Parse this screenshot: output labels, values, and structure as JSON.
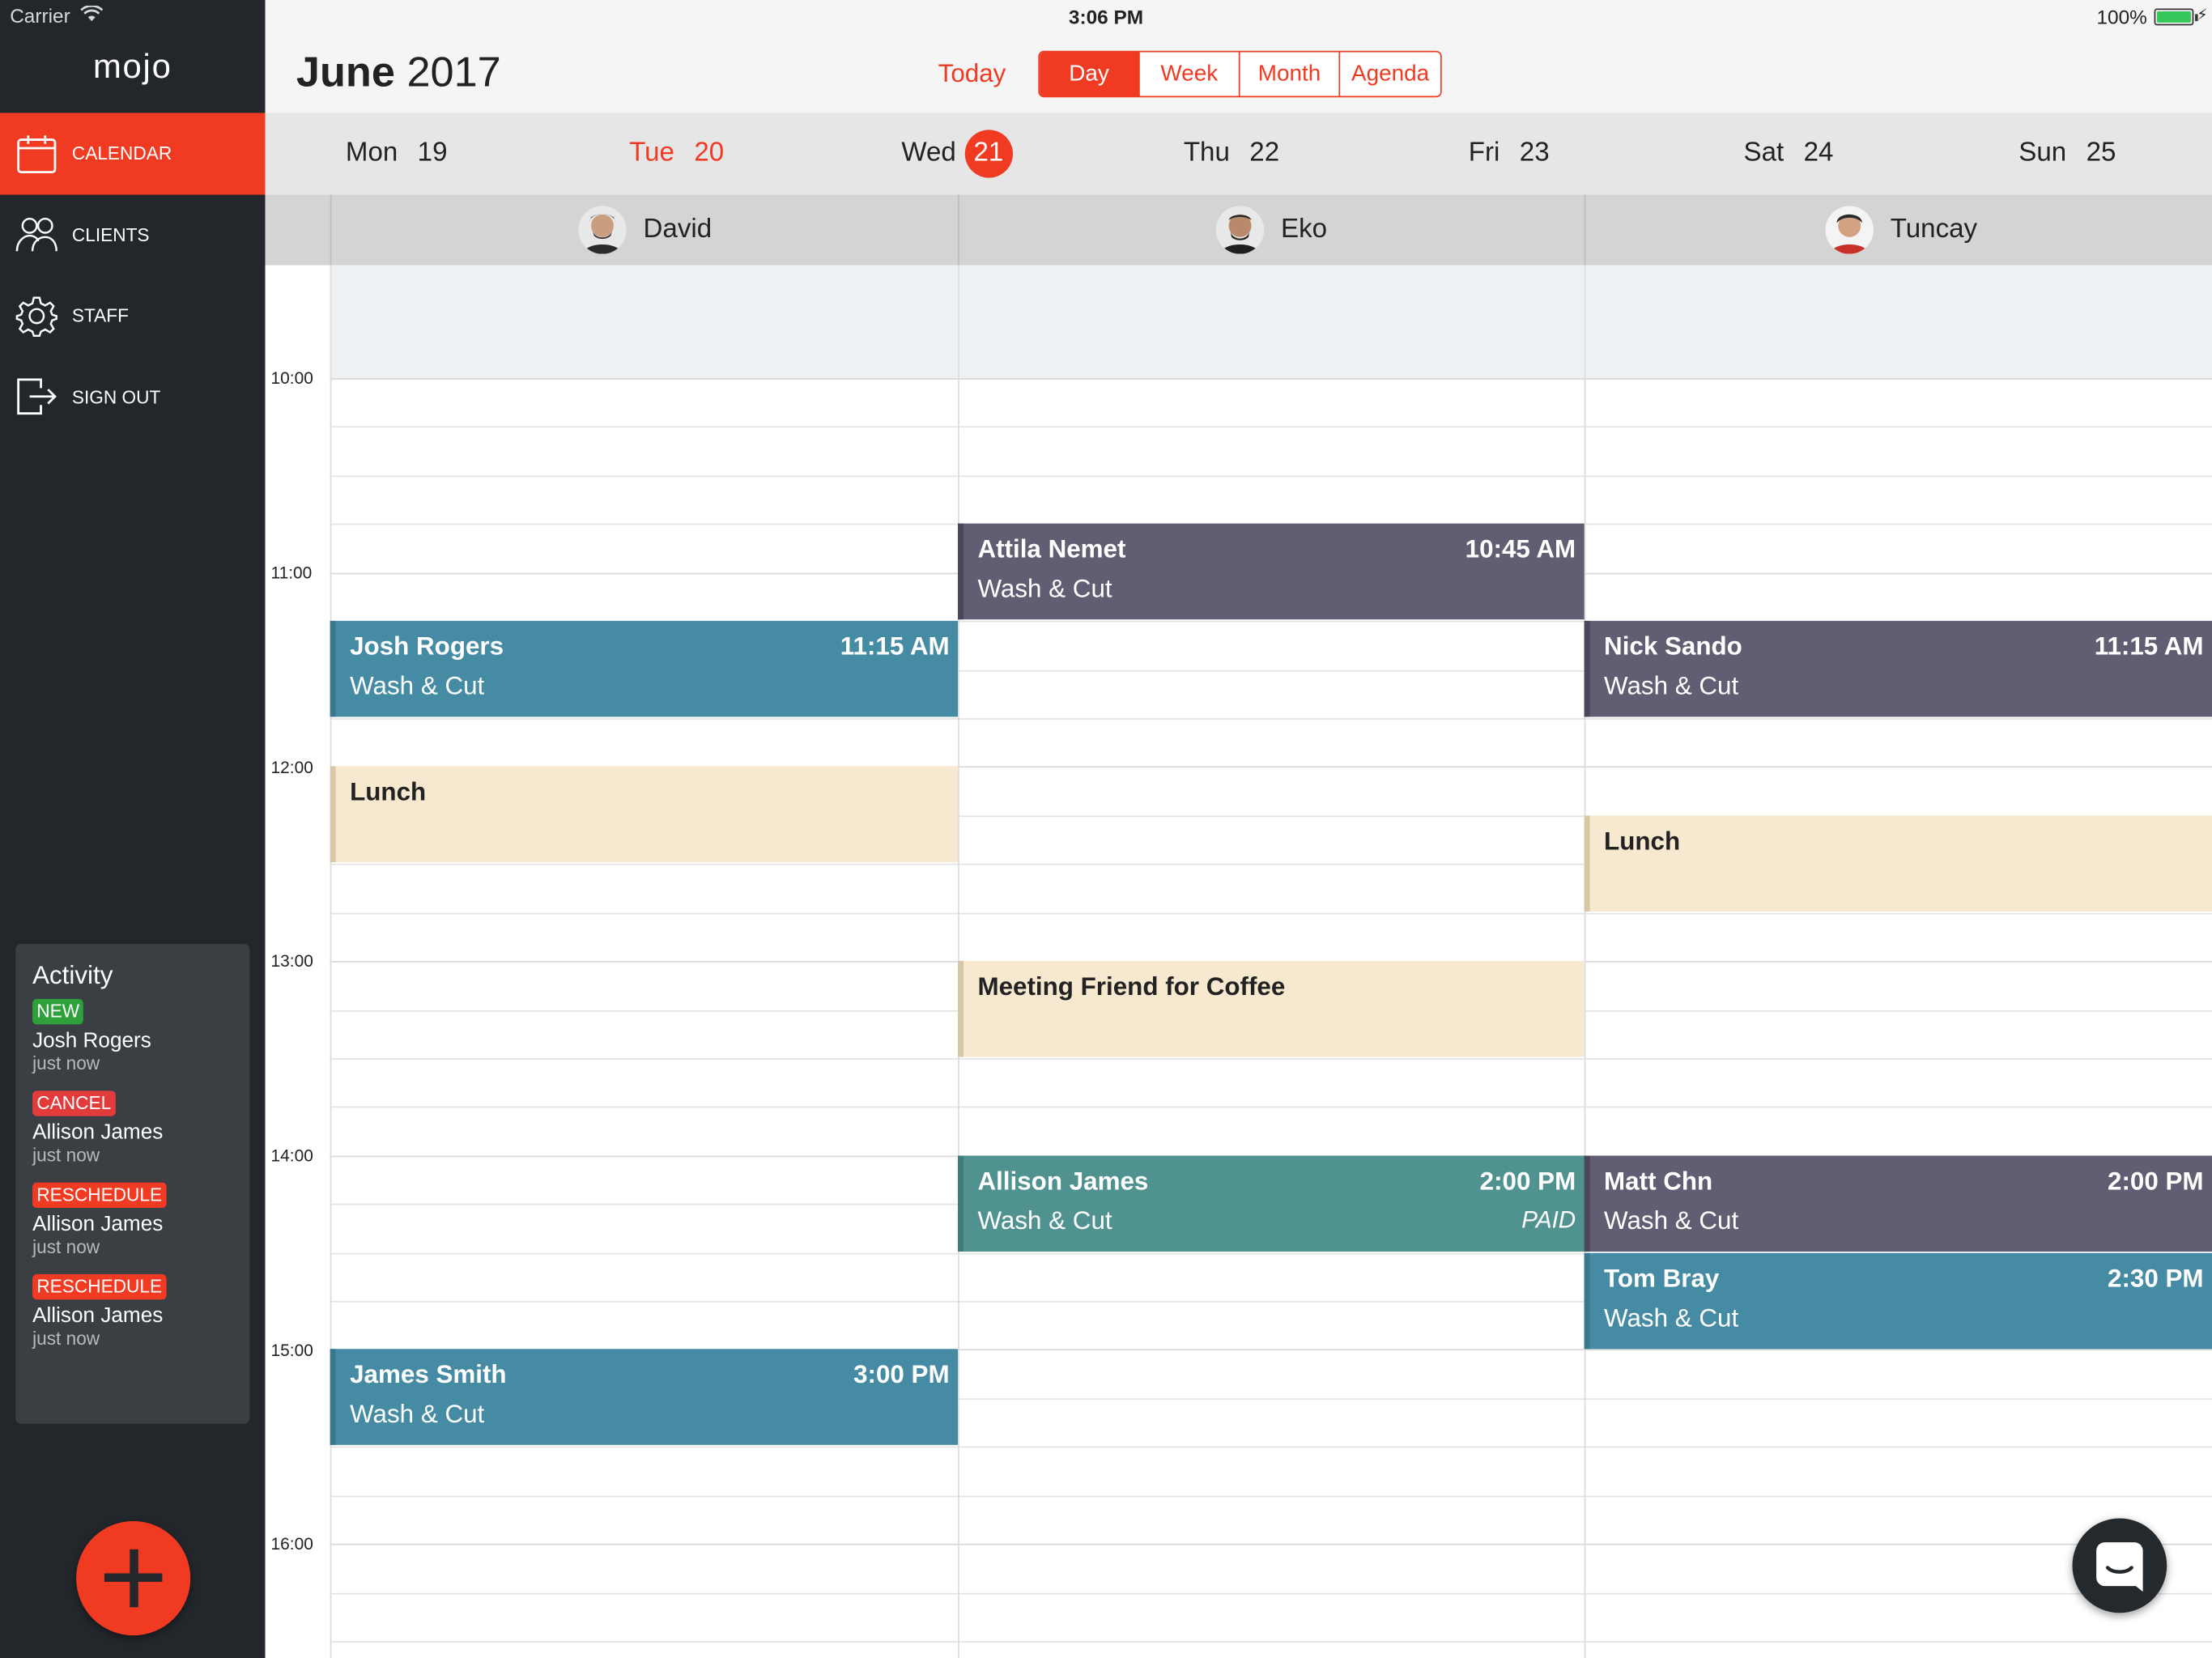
{
  "status_bar": {
    "carrier": "Carrier",
    "time": "3:06 PM",
    "battery": "100%"
  },
  "sidebar": {
    "logo": "mojo",
    "nav": [
      {
        "label": "CALENDAR",
        "icon": "calendar-icon",
        "active": true
      },
      {
        "label": "CLIENTS",
        "icon": "clients-icon",
        "active": false
      },
      {
        "label": "STAFF",
        "icon": "gear-icon",
        "active": false
      },
      {
        "label": "SIGN OUT",
        "icon": "sign-out-icon",
        "active": false
      }
    ],
    "activity": {
      "title": "Activity",
      "items": [
        {
          "badge": "NEW",
          "name": "Josh Rogers",
          "time": "just now"
        },
        {
          "badge": "CANCEL",
          "name": "Allison James",
          "time": "just now"
        },
        {
          "badge": "RESCHEDULE",
          "name": "Allison James",
          "time": "just now"
        },
        {
          "badge": "RESCHEDULE",
          "name": "Allison James",
          "time": "just now"
        }
      ]
    },
    "fab_icon": "plus-icon"
  },
  "header": {
    "month": "June",
    "year": "2017",
    "today_label": "Today",
    "views": [
      "Day",
      "Week",
      "Month",
      "Agenda"
    ],
    "active_view": "Day"
  },
  "days": [
    {
      "name": "Mon",
      "num": "19"
    },
    {
      "name": "Tue",
      "num": "20"
    },
    {
      "name": "Wed",
      "num": "21"
    },
    {
      "name": "Thu",
      "num": "22"
    },
    {
      "name": "Fri",
      "num": "23"
    },
    {
      "name": "Sat",
      "num": "24"
    },
    {
      "name": "Sun",
      "num": "25"
    }
  ],
  "staff": [
    {
      "name": "David"
    },
    {
      "name": "Eko"
    },
    {
      "name": "Tuncay"
    }
  ],
  "time_labels": [
    "10:00",
    "11:00",
    "12:00",
    "13:00",
    "14:00",
    "15:00",
    "16:00"
  ],
  "events": {
    "attila": {
      "client": "Attila Nemet",
      "service": "Wash & Cut",
      "time": "10:45 AM"
    },
    "josh": {
      "client": "Josh Rogers",
      "service": "Wash & Cut",
      "time": "11:15 AM"
    },
    "nick": {
      "client": "Nick Sando",
      "service": "Wash & Cut",
      "time": "11:15 AM"
    },
    "lunch_david": {
      "title": "Lunch"
    },
    "lunch_tuncay": {
      "title": "Lunch"
    },
    "coffee": {
      "title": "Meeting Friend for Coffee"
    },
    "allison": {
      "client": "Allison James",
      "service": "Wash & Cut",
      "time": "2:00 PM",
      "status": "PAID"
    },
    "matt": {
      "client": "Matt Chn",
      "service": "Wash & Cut",
      "time": "2:00 PM"
    },
    "tom": {
      "client": "Tom Bray",
      "service": "Wash & Cut",
      "time": "2:30 PM"
    },
    "james": {
      "client": "James Smith",
      "service": "Wash & Cut",
      "time": "3:00 PM"
    }
  },
  "colors": {
    "accent": "#f13a22",
    "sidebar": "#23272b",
    "purple_event": "#625d73",
    "blue_event": "#458ba3",
    "teal_event": "#509290",
    "lunch_event": "#f7e9cf"
  }
}
